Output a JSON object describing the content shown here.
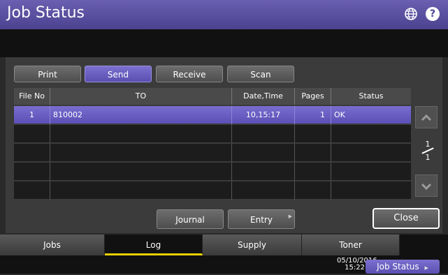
{
  "header": {
    "title": "Job Status",
    "globe_icon": "globe-icon",
    "help_icon": "help-icon",
    "help_glyph": "?"
  },
  "sub_tabs": [
    {
      "label": "Print",
      "active": false
    },
    {
      "label": "Send",
      "active": true
    },
    {
      "label": "Receive",
      "active": false
    },
    {
      "label": "Scan",
      "active": false
    }
  ],
  "table": {
    "columns": [
      "File No",
      "TO",
      "Date,Time",
      "Pages",
      "Status"
    ],
    "rows": [
      {
        "file_no": "1",
        "to": "810002",
        "date_time": "10,15:17",
        "pages": "1",
        "status": "OK",
        "selected": true
      }
    ],
    "empty_rows": 4
  },
  "pager": {
    "current": "1",
    "total": "1",
    "up_icon": "chevron-up-icon",
    "down_icon": "chevron-down-icon"
  },
  "actions": {
    "journal": "Journal",
    "entry": "Entry",
    "close": "Close"
  },
  "bottom_tabs": [
    {
      "label": "Jobs",
      "active": false
    },
    {
      "label": "Log",
      "active": true
    },
    {
      "label": "Supply",
      "active": false
    },
    {
      "label": "Toner",
      "active": false
    }
  ],
  "status_bar": {
    "date": "05/10/2016",
    "time": "15:22",
    "job_status_button": "Job Status"
  },
  "colors": {
    "accent": "#5a4fb0",
    "tab_indicator": "#e8d000"
  }
}
